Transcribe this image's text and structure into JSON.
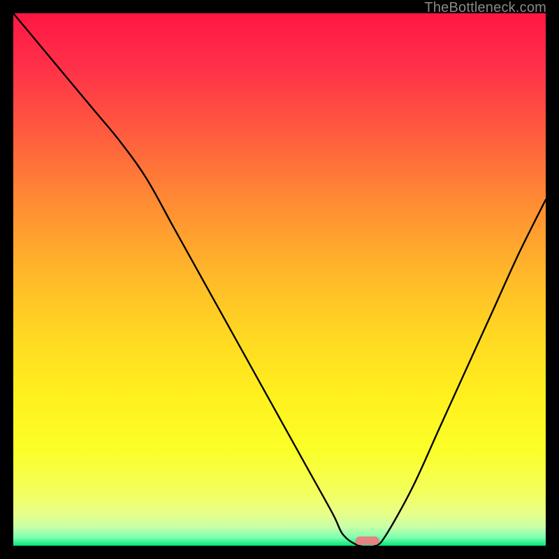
{
  "watermark": "TheBottleneck.com",
  "chart_data": {
    "type": "line",
    "title": "",
    "xlabel": "",
    "ylabel": "",
    "xlim": [
      0,
      100
    ],
    "ylim": [
      0,
      100
    ],
    "grid": false,
    "series": [
      {
        "name": "curve",
        "color": "#000000",
        "x": [
          0,
          5,
          10,
          15,
          20,
          25,
          30,
          35,
          40,
          45,
          50,
          55,
          60,
          62,
          65,
          68,
          70,
          75,
          80,
          85,
          90,
          95,
          100
        ],
        "y": [
          100,
          94,
          88,
          82,
          76,
          69,
          60,
          51,
          42,
          33,
          24,
          15,
          6,
          2,
          0,
          0,
          2,
          11,
          22,
          33,
          44,
          55,
          65
        ]
      }
    ],
    "marker": {
      "name": "highlight-pill",
      "color": "#e58382",
      "x_center": 66.5,
      "width_pct": 4.5,
      "height_pct": 1.6
    },
    "background": {
      "type": "vertical-gradient",
      "stops": [
        {
          "offset": 0.0,
          "color": "#ff1744"
        },
        {
          "offset": 0.1,
          "color": "#ff3049"
        },
        {
          "offset": 0.22,
          "color": "#ff5a3f"
        },
        {
          "offset": 0.35,
          "color": "#ff8a34"
        },
        {
          "offset": 0.48,
          "color": "#ffb52a"
        },
        {
          "offset": 0.6,
          "color": "#ffd722"
        },
        {
          "offset": 0.72,
          "color": "#fff01e"
        },
        {
          "offset": 0.82,
          "color": "#fbff28"
        },
        {
          "offset": 0.9,
          "color": "#f3ff5e"
        },
        {
          "offset": 0.94,
          "color": "#e7ff8a"
        },
        {
          "offset": 0.965,
          "color": "#c8ffa8"
        },
        {
          "offset": 0.985,
          "color": "#7affb0"
        },
        {
          "offset": 1.0,
          "color": "#00e676"
        }
      ]
    }
  }
}
